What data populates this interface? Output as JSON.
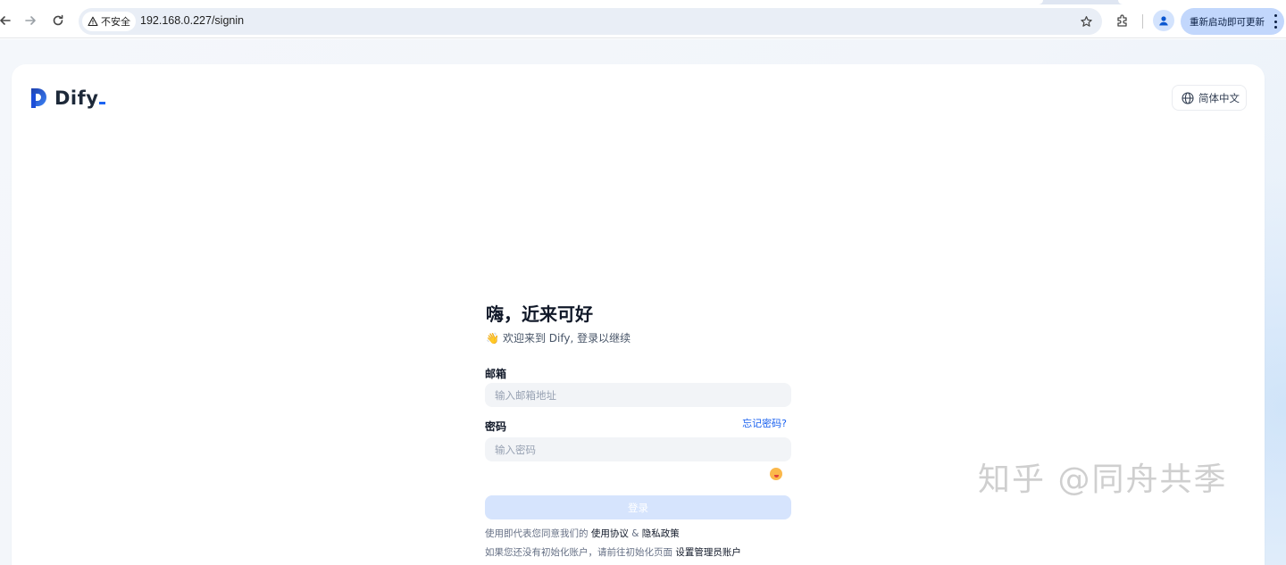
{
  "browser": {
    "security_label": "不安全",
    "url": "192.168.0.227/signin",
    "update_label": "重新启动即可更新"
  },
  "header": {
    "logo_text": "Dify",
    "language_label": "简体中文"
  },
  "signin": {
    "greeting": "嗨，近来可好",
    "wave_emoji": "👋",
    "welcome_text": "欢迎来到 Dify, 登录以继续",
    "email_label": "邮箱",
    "email_placeholder": "输入邮箱地址",
    "password_label": "密码",
    "forgot_label": "忘记密码?",
    "password_placeholder": "输入密码",
    "submit_label": "登录",
    "terms_prefix": "使用即代表您同意我们的",
    "terms_link": "使用协议",
    "terms_amp": "&",
    "privacy_link": "隐私政策",
    "init_prefix": "如果您还没有初始化账户，请前往初始化页面",
    "init_link": "设置管理员账户"
  },
  "watermark": "知乎 @同舟共季",
  "colors": {
    "accent": "#155eef",
    "submit_disabled": "#d6e4fd",
    "input_bg": "#f2f4f7"
  }
}
